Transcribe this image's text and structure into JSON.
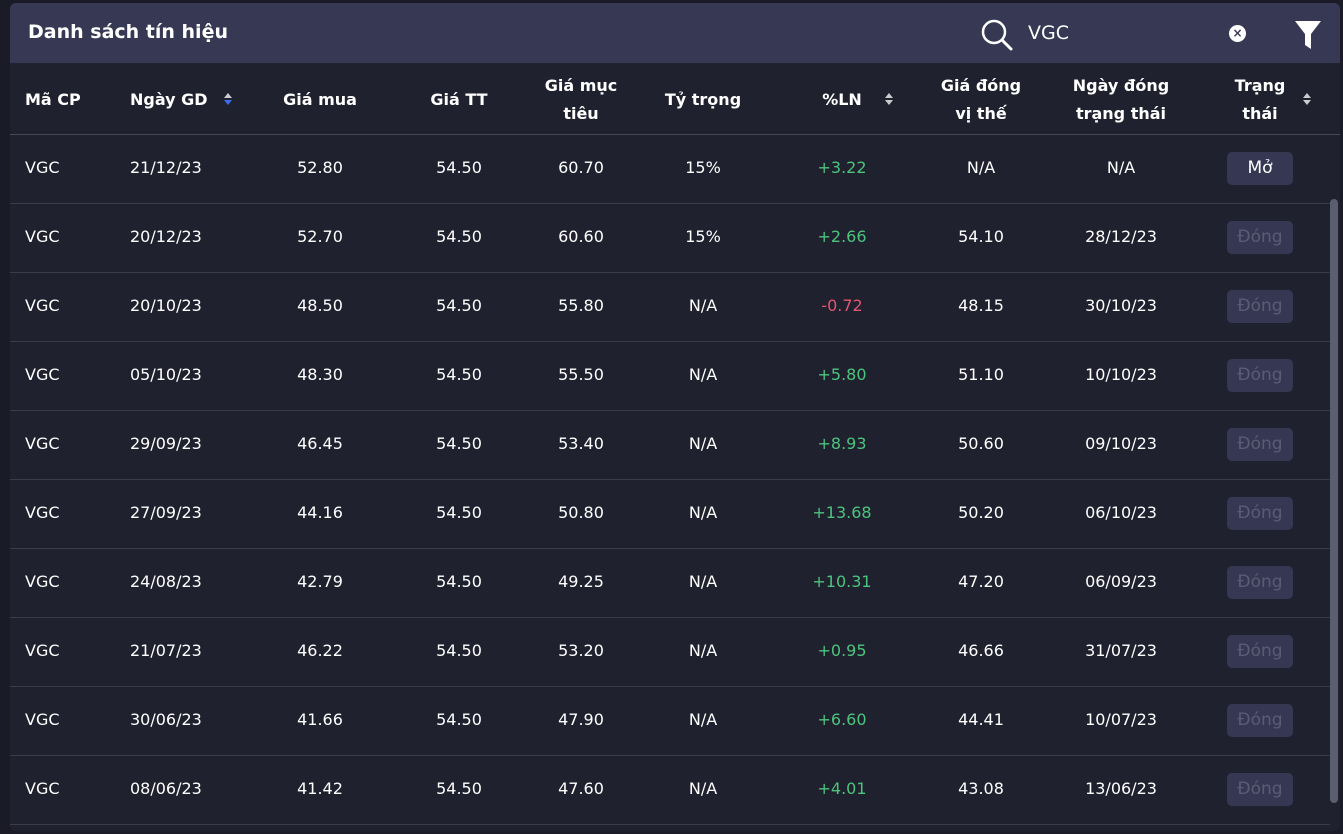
{
  "header": {
    "title": "Danh sách tín hiệu",
    "search_value": "VGC"
  },
  "columns": [
    "Mã CP",
    "Ngày GD",
    "Giá mua",
    "Giá TT",
    "Giá mục tiêu",
    "Tỷ trọng",
    "%LN",
    "Giá đóng vị thế",
    "Ngày đóng trạng thái",
    "Trạng thái"
  ],
  "column_lines": {
    "c4": [
      "Giá mục",
      "tiêu"
    ],
    "c7": [
      "Giá đóng",
      "vị thế"
    ],
    "c8": [
      "Ngày đóng",
      "trạng thái"
    ],
    "c9": [
      "Trạng",
      "thái"
    ]
  },
  "colors": {
    "positive": "#4cc47c",
    "negative": "#e0566e",
    "sort_active": "#3b6cf0"
  },
  "rows": [
    [
      "VGC",
      "21/12/23",
      "52.80",
      "54.50",
      "60.70",
      "15%",
      "+3.22",
      "N/A",
      "N/A",
      "Mở"
    ],
    [
      "VGC",
      "20/12/23",
      "52.70",
      "54.50",
      "60.60",
      "15%",
      "+2.66",
      "54.10",
      "28/12/23",
      "Đóng"
    ],
    [
      "VGC",
      "20/10/23",
      "48.50",
      "54.50",
      "55.80",
      "N/A",
      "-0.72",
      "48.15",
      "30/10/23",
      "Đóng"
    ],
    [
      "VGC",
      "05/10/23",
      "48.30",
      "54.50",
      "55.50",
      "N/A",
      "+5.80",
      "51.10",
      "10/10/23",
      "Đóng"
    ],
    [
      "VGC",
      "29/09/23",
      "46.45",
      "54.50",
      "53.40",
      "N/A",
      "+8.93",
      "50.60",
      "09/10/23",
      "Đóng"
    ],
    [
      "VGC",
      "27/09/23",
      "44.16",
      "54.50",
      "50.80",
      "N/A",
      "+13.68",
      "50.20",
      "06/10/23",
      "Đóng"
    ],
    [
      "VGC",
      "24/08/23",
      "42.79",
      "54.50",
      "49.25",
      "N/A",
      "+10.31",
      "47.20",
      "06/09/23",
      "Đóng"
    ],
    [
      "VGC",
      "21/07/23",
      "46.22",
      "54.50",
      "53.20",
      "N/A",
      "+0.95",
      "46.66",
      "31/07/23",
      "Đóng"
    ],
    [
      "VGC",
      "30/06/23",
      "41.66",
      "54.50",
      "47.90",
      "N/A",
      "+6.60",
      "44.41",
      "10/07/23",
      "Đóng"
    ],
    [
      "VGC",
      "08/06/23",
      "41.42",
      "54.50",
      "47.60",
      "N/A",
      "+4.01",
      "43.08",
      "13/06/23",
      "Đóng"
    ]
  ]
}
